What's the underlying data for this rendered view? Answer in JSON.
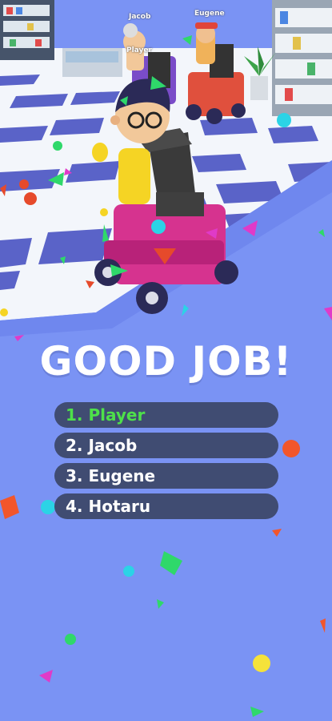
{
  "title": "GOOD JOB!",
  "players_on_track": {
    "tag_1": "Jacob",
    "tag_2": "Eugene",
    "tag_3": "Player"
  },
  "leaderboard": [
    {
      "label": "1. Player",
      "highlight": true
    },
    {
      "label": "2. Jacob",
      "highlight": false
    },
    {
      "label": "3. Eugene",
      "highlight": false
    },
    {
      "label": "4. Hotaru",
      "highlight": false
    }
  ],
  "colors": {
    "background": "#7a93f4",
    "row_bg": "#404c72",
    "winner_text": "#4ee04a"
  }
}
